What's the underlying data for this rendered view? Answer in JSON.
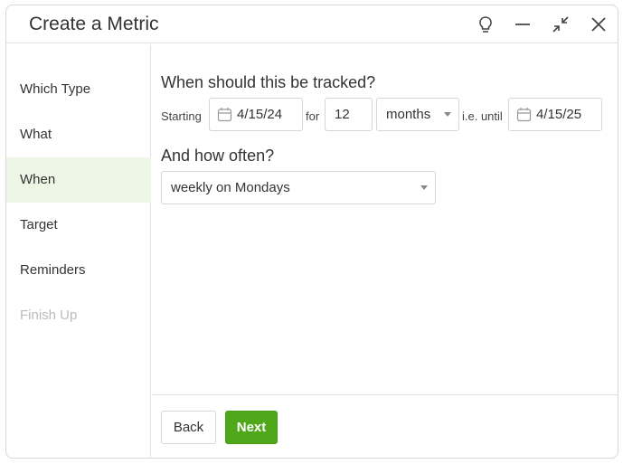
{
  "header": {
    "title": "Create a Metric",
    "icons": [
      "lightbulb-icon",
      "minimize-icon",
      "collapse-icon",
      "close-icon"
    ]
  },
  "sidebar": {
    "items": [
      {
        "label": "Which Type"
      },
      {
        "label": "What"
      },
      {
        "label": "When",
        "active": true
      },
      {
        "label": "Target"
      },
      {
        "label": "Reminders"
      },
      {
        "label": "Finish Up",
        "disabled": true
      }
    ]
  },
  "main": {
    "q1": "When should this be tracked?",
    "starting_label": "Starting",
    "start_date": "4/15/24",
    "for_label": "for",
    "duration": "12",
    "unit": "months",
    "until_label": "i.e. until",
    "end_date": "4/15/25",
    "q2": "And how often?",
    "frequency": "weekly on Mondays"
  },
  "footer": {
    "back": "Back",
    "next": "Next"
  },
  "colors": {
    "accent": "#4fa71a",
    "active_bg": "#eef6e6"
  }
}
